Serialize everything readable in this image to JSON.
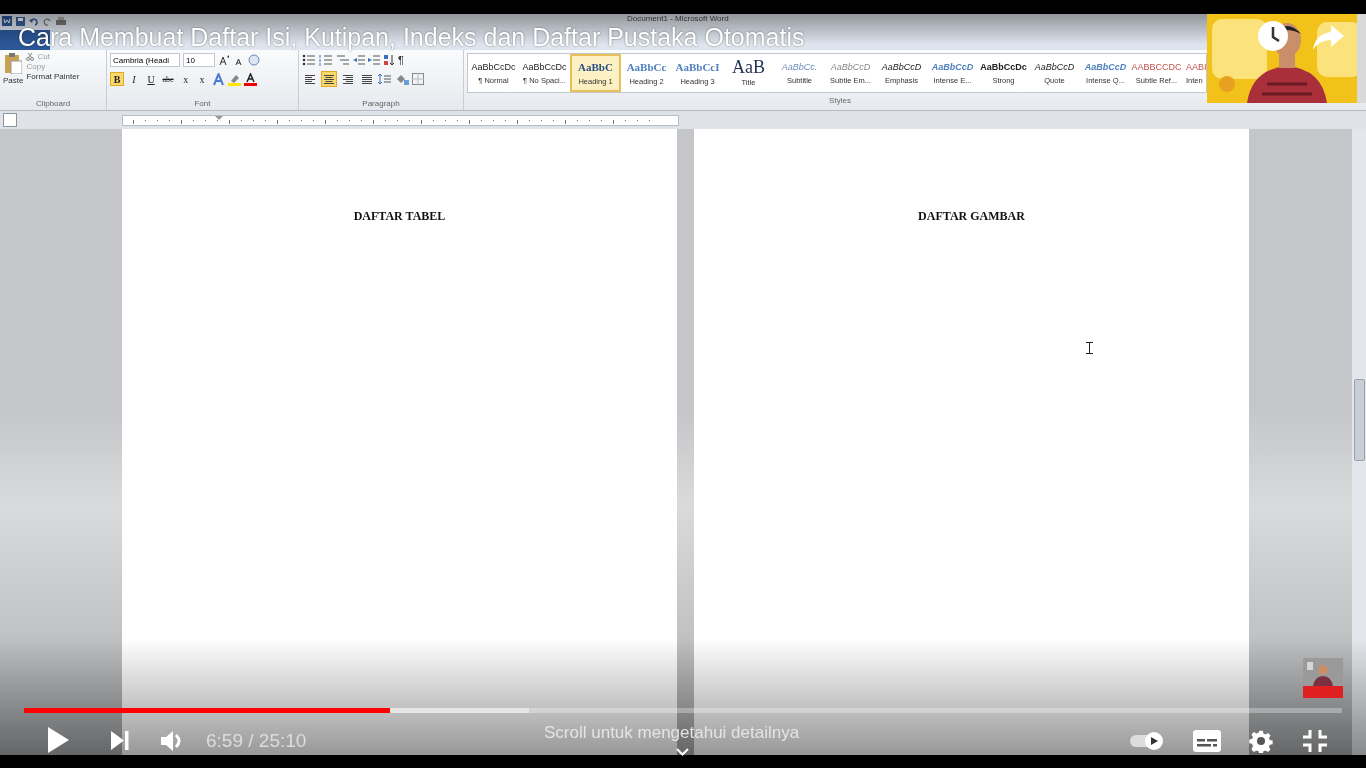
{
  "video": {
    "title": "Cara Membuat Daftar Isi, Kutipan, Indeks dan Daftar Pustaka Otomatis"
  },
  "word": {
    "window_title": "Document1 - Microsoft Word",
    "clipboard": {
      "paste": "Paste",
      "cut": "Cut",
      "copy": "Copy",
      "format_painter": "Format Painter",
      "label": "Clipboard"
    },
    "font": {
      "name": "Cambria (Headi",
      "size": "10",
      "label": "Font",
      "buttons": [
        {
          "label": "B",
          "kind": "bold",
          "selected": true
        },
        {
          "label": "I",
          "kind": "italic",
          "selected": false
        },
        {
          "label": "U",
          "kind": "underline",
          "selected": false
        },
        {
          "label": "abc",
          "kind": "strike",
          "selected": false
        },
        {
          "label": "x",
          "kind": "sub",
          "selected": false
        },
        {
          "label": "x",
          "kind": "sup",
          "selected": false
        }
      ]
    },
    "paragraph": {
      "label": "Paragraph",
      "pilcrow": "¶",
      "align": [
        {
          "kind": "left",
          "selected": false
        },
        {
          "kind": "center",
          "selected": true
        },
        {
          "kind": "right",
          "selected": false
        },
        {
          "kind": "justify",
          "selected": false
        }
      ]
    },
    "styles": {
      "label": "Styles",
      "items": [
        {
          "sample": "AaBbCcDc",
          "name": "¶ Normal",
          "kind": "plain",
          "selected": false
        },
        {
          "sample": "AaBbCcDc",
          "name": "¶ No Spaci...",
          "kind": "plain",
          "selected": false
        },
        {
          "sample": "AaBbC",
          "name": "Heading 1",
          "kind": "heading1",
          "selected": true
        },
        {
          "sample": "AaBbCc",
          "name": "Heading 2",
          "kind": "heading",
          "selected": false
        },
        {
          "sample": "AaBbCcI",
          "name": "Heading 3",
          "kind": "heading",
          "selected": false
        },
        {
          "sample": "AaB",
          "name": "Title",
          "kind": "large",
          "selected": false
        },
        {
          "sample": "AaBbCc.",
          "name": "Subtitle",
          "kind": "subtitle",
          "selected": false
        },
        {
          "sample": "AaBbCcD",
          "name": "Subtle Em...",
          "kind": "subtle",
          "selected": false
        },
        {
          "sample": "AaBbCcD",
          "name": "Emphasis",
          "kind": "italic",
          "selected": false
        },
        {
          "sample": "AaBbCcD",
          "name": "Intense E...",
          "kind": "intense",
          "selected": false
        },
        {
          "sample": "AaBbCcDc",
          "name": "Strong",
          "kind": "bold",
          "selected": false
        },
        {
          "sample": "AaBbCcD",
          "name": "Quote",
          "kind": "italic",
          "selected": false
        },
        {
          "sample": "AaBbCcD",
          "name": "Intense Q...",
          "kind": "intense",
          "selected": false
        },
        {
          "sample": "AABBCCDC",
          "name": "Subtle Ref...",
          "kind": "reference",
          "selected": false
        },
        {
          "sample": "AABI",
          "name": "Inten",
          "kind": "reference",
          "selected": false
        }
      ]
    },
    "pages": [
      {
        "heading": "DAFTAR TABEL"
      },
      {
        "heading": "DAFTAR GAMBAR"
      }
    ]
  },
  "player": {
    "progress": {
      "level": 0.278
    },
    "buffer": {
      "level": 0.383
    },
    "time": "6:59 / 25:10",
    "hint": "Scroll untuk mengetahui detailnya",
    "autoplay": {
      "on": true
    }
  }
}
